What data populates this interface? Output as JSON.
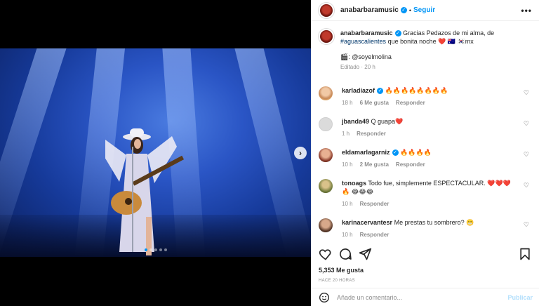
{
  "post": {
    "username": "anabarbaramusic",
    "separator": "•",
    "follow_label": "Seguir",
    "more_label": "•••"
  },
  "caption": {
    "username": "anabarbaramusic",
    "text_1": "Gracias Pedazos de mi alma, de",
    "hashtag": "#aguascalientes",
    "text_2": "que bonita noche ❤️ 🇦🇺 🇰🇷mx",
    "credit": "🎬: @soyelmolina",
    "meta": "Editado · 20 h"
  },
  "comments": [
    {
      "username": "karladiazof",
      "text": "🔥🔥🔥🔥🔥🔥🔥🔥",
      "time": "18 h",
      "likes": "6 Me gusta",
      "reply": "Responder",
      "verified": true
    },
    {
      "username": "jbanda49",
      "text": "Q guapa❤️",
      "time": "1 h",
      "likes": "",
      "reply": "Responder",
      "verified": false
    },
    {
      "username": "eldamarlagarniz",
      "text": "🔥🔥🔥🔥",
      "time": "10 h",
      "likes": "2 Me gusta",
      "reply": "Responder",
      "verified": true
    },
    {
      "username": "tonoags",
      "text": "Todo fue, simplemente ESPECTACULAR. ❤️❤️❤️🔥 😂😂😂",
      "time": "10 h",
      "likes": "",
      "reply": "Responder",
      "verified": false
    },
    {
      "username": "karinacervantesr",
      "text": "Me prestas tu sombrero? 😬",
      "time": "10 h",
      "likes": "",
      "reply": "Responder",
      "verified": false
    }
  ],
  "stats": {
    "likes": "5,353 Me gusta",
    "posted": "HACE 20 HORAS"
  },
  "composer": {
    "placeholder": "Añade un comentario...",
    "publish_label": "Publicar"
  },
  "icons": {
    "emoji": "emoji-icon",
    "like": "heart-icon",
    "comment": "comment-icon",
    "share": "share-icon",
    "save": "bookmark-icon",
    "next": "chevron-right-icon"
  },
  "colors": {
    "accent": "#0095f6",
    "publish_disabled": "#b2dffc",
    "muted": "#8e8e8e",
    "stage_blue": "#2a55c5"
  }
}
